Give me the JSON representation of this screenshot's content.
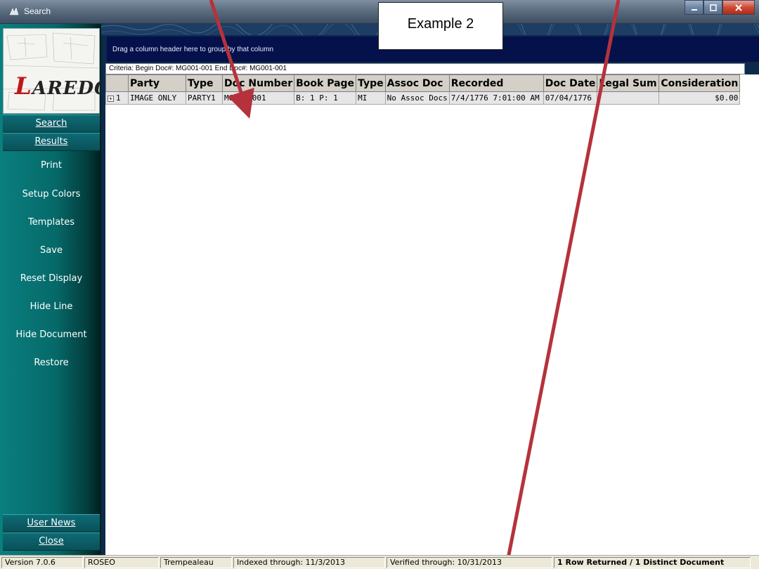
{
  "window": {
    "title": "Search",
    "accent": "#5c6d80"
  },
  "callout": {
    "text": "Example 2"
  },
  "sidebar": {
    "logo_text_rest": "AREDO",
    "logo_text_first": "L",
    "tabs": {
      "search": "Search",
      "results": "Results"
    },
    "items": [
      {
        "label": "Print"
      },
      {
        "label": "Setup Colors"
      },
      {
        "label": "Templates"
      },
      {
        "label": "Save"
      },
      {
        "label": "Reset Display"
      },
      {
        "label": "Hide Line"
      },
      {
        "label": "Hide Document"
      },
      {
        "label": "Restore"
      }
    ],
    "bottom": {
      "user_news": "User News",
      "close": "Close"
    },
    "colors": {
      "teal": "#0a7f7f",
      "dark": "#011e1e"
    }
  },
  "results": {
    "group_hint": "Drag a column header here to group by that column",
    "criteria": "Criteria: Begin Doc#: MG001-001 End Doc#: MG001-001",
    "columns": [
      "Party",
      "Type",
      "Doc Number",
      "Book Page",
      "Type",
      "Assoc Doc",
      "Recorded",
      "Doc Date",
      "Legal Sum",
      "Consideration"
    ],
    "rows": [
      {
        "expand": "+",
        "index": "1",
        "cells": [
          "IMAGE ONLY",
          "PARTY1",
          "MG001-001",
          "B: 1 P: 1",
          "MI",
          "No Assoc Docs",
          "7/4/1776 7:01:00 AM",
          "07/04/1776",
          "",
          "$0.00"
        ]
      }
    ]
  },
  "status": {
    "version": "Version 7.0.6",
    "user": "ROSEO",
    "county": "Trempealeau",
    "indexed": "Indexed through: 11/3/2013",
    "verified": "Verified through: 10/31/2013",
    "rows": "1 Row Returned / 1 Distinct Document"
  }
}
